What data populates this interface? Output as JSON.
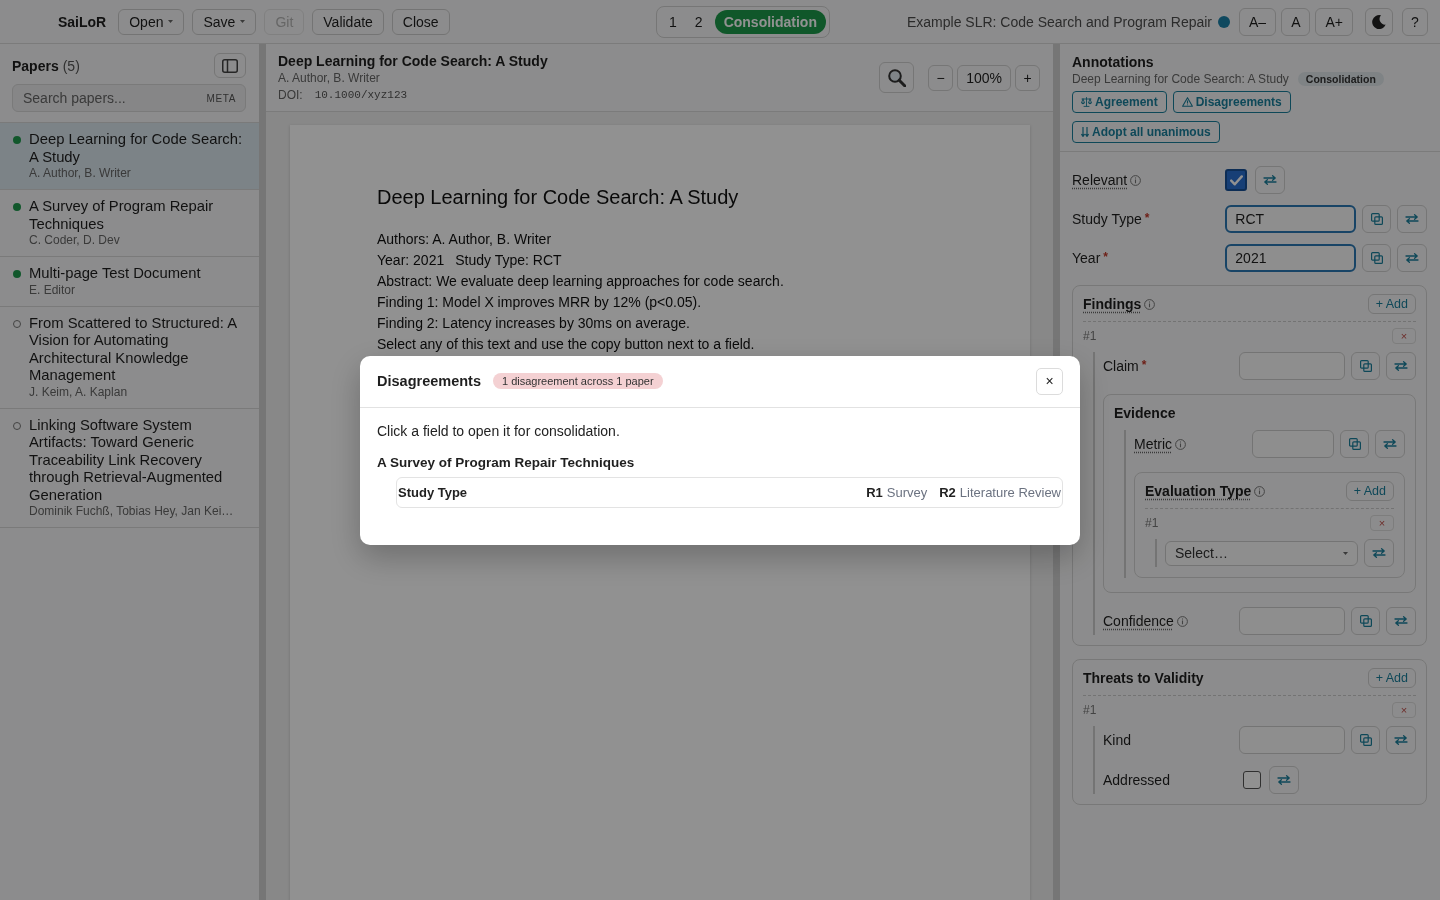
{
  "app": {
    "name": "SaiLoR"
  },
  "toolbar": [
    {
      "label": "Open",
      "menu": true,
      "disabled": false
    },
    {
      "label": "Save",
      "menu": true,
      "disabled": false
    },
    {
      "label": "Git",
      "menu": false,
      "disabled": true
    },
    {
      "label": "Validate",
      "menu": false,
      "disabled": false
    },
    {
      "label": "Close",
      "menu": false,
      "disabled": false
    }
  ],
  "modes": [
    {
      "label": "1",
      "selected": false
    },
    {
      "label": "2",
      "selected": false
    },
    {
      "label": "Consolidation",
      "selected": true
    }
  ],
  "project": {
    "title": "Example SLR: Code Search and Program Repair",
    "synced": true
  },
  "display_buttons": [
    "A–",
    "A",
    "A+"
  ],
  "help_label": "?",
  "sidebar": {
    "title": "Papers",
    "count": "(5)",
    "search": {
      "placeholder": "Search papers...",
      "scope": "META"
    },
    "papers": [
      {
        "title": "Deep Learning for Code Search: A Study",
        "authors": "A. Author, B. Writer",
        "annotated": true,
        "selected": true
      },
      {
        "title": "A Survey of Program Repair Techniques",
        "authors": "C. Coder, D. Dev",
        "annotated": true,
        "selected": false
      },
      {
        "title": "Multi-page Test Document",
        "authors": "E. Editor",
        "annotated": true,
        "selected": false
      },
      {
        "title": "From Scattered to Structured: A Vision for Automating Architectural Knowledge Management",
        "authors": "J. Keim, A. Kaplan",
        "annotated": false,
        "selected": false
      },
      {
        "title": "Linking Software System Artifacts: Toward Generic Traceability Link Recovery through Retrieval-Augmented Generation",
        "authors": "Dominik Fuchß, Tobias Hey, Jan Kei…",
        "annotated": false,
        "selected": false
      }
    ]
  },
  "viewer": {
    "title": "Deep Learning for Code Search: A Study",
    "authors": "A. Author, B. Writer",
    "doi_label": "DOI:",
    "doi": "10.1000/xyz123",
    "zoom_out": "−",
    "zoom_text": "100%",
    "zoom_in": "+",
    "document": {
      "title": "Deep Learning for Code Search: A Study",
      "lines": [
        [
          "Authors: A. Author, B. Writer"
        ],
        [
          "Year: 2021",
          "Study Type: RCT"
        ],
        [
          "Abstract: We evaluate deep learning approaches for code search."
        ],
        [
          "Finding 1: Model X improves MRR by 12% (p<0.05)."
        ],
        [
          "Finding 2: Latency increases by 30ms on average."
        ],
        [
          "Select any of this text and use the copy button next to a field."
        ]
      ]
    }
  },
  "annotations": {
    "title": "Annotations",
    "paper": "Deep Learning for Code Search: A Study",
    "mode_badge": "Consolidation",
    "actions": [
      {
        "kind": "agreement",
        "label": "Agreement"
      },
      {
        "kind": "disagreements",
        "label": "Disagreements"
      },
      {
        "kind": "adopt",
        "label": "Adopt all unanimous"
      }
    ],
    "fields": [
      {
        "kind": "checkbox",
        "label": "Relevant",
        "info": true,
        "checked": true
      },
      {
        "kind": "text",
        "label": "Study Type",
        "info": false,
        "required_mark": "*",
        "value": "RCT"
      },
      {
        "kind": "text",
        "label": "Year",
        "info": false,
        "required_mark": "*",
        "value": "2021"
      },
      {
        "kind": "group",
        "label": "Findings",
        "info": true,
        "add_label": "+ Add",
        "entries": [
          {
            "number": "#1",
            "remove_label": "×",
            "fields": [
              {
                "kind": "text",
                "label": "Claim",
                "info": false,
                "required_mark": "*"
              },
              {
                "kind": "section",
                "label": "Evidence",
                "fields": [
                  {
                    "kind": "text",
                    "label": "Metric",
                    "info": true
                  },
                  {
                    "kind": "group",
                    "label": "Evaluation Type",
                    "info": true,
                    "add_label": "+ Add",
                    "entries": [
                      {
                        "number": "#1",
                        "remove_label": "×",
                        "fields": [
                          {
                            "kind": "select",
                            "placeholder": "Select…"
                          }
                        ]
                      }
                    ]
                  }
                ]
              },
              {
                "kind": "text",
                "label": "Confidence",
                "info": true
              }
            ]
          }
        ]
      },
      {
        "kind": "group",
        "label": "Threats to Validity",
        "info": false,
        "add_label": "+ Add",
        "entries": [
          {
            "number": "#1",
            "remove_label": "×",
            "fields": [
              {
                "kind": "text",
                "label": "Kind",
                "info": false
              },
              {
                "kind": "checkbox",
                "label": "Addressed",
                "info": false,
                "checked": false
              }
            ]
          }
        ]
      }
    ]
  },
  "dialog": {
    "title": "Disagreements",
    "summary": "1 disagreement across 1 paper",
    "close_label": "×",
    "intro": "Click a field to open it for consolidation.",
    "papers": [
      {
        "title": "A Survey of Program Repair Techniques",
        "fields": [
          {
            "label": "Study Type",
            "ratings": [
              {
                "rater": "R1",
                "value": "Survey"
              },
              {
                "rater": "R2",
                "value": "Literature Review"
              }
            ]
          }
        ]
      }
    ]
  }
}
